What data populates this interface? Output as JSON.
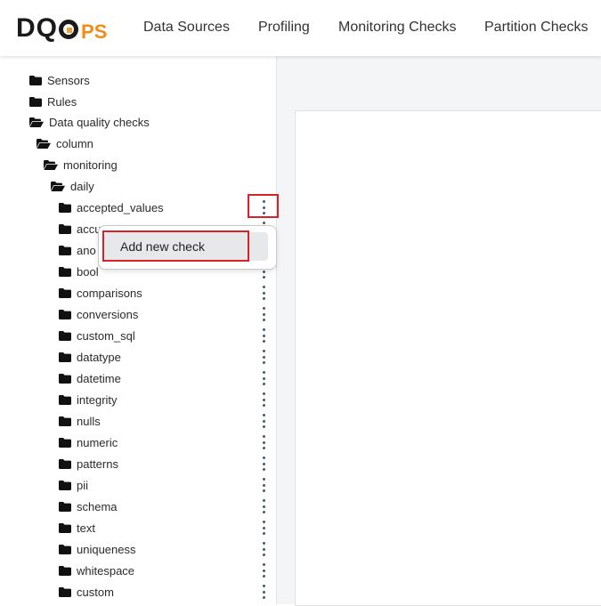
{
  "brand": {
    "logo_text": "DQOps",
    "accent": "#f08c1a"
  },
  "nav": [
    {
      "label": "Data Sources"
    },
    {
      "label": "Profiling"
    },
    {
      "label": "Monitoring Checks"
    },
    {
      "label": "Partition Checks"
    }
  ],
  "tree": {
    "top_items": [
      {
        "label": "Sensors",
        "icon": "folder-icon"
      },
      {
        "label": "Rules",
        "icon": "folder-icon"
      },
      {
        "label": "Data quality checks",
        "icon": "folder-open-icon"
      },
      {
        "label": "column",
        "icon": "folder-open-icon"
      },
      {
        "label": "monitoring",
        "icon": "folder-open-icon"
      },
      {
        "label": "daily",
        "icon": "folder-open-icon"
      }
    ],
    "categories": [
      "accepted_values",
      "accu",
      "ano",
      "bool",
      "comparisons",
      "conversions",
      "custom_sql",
      "datatype",
      "datetime",
      "integrity",
      "nulls",
      "numeric",
      "patterns",
      "pii",
      "schema",
      "text",
      "uniqueness",
      "whitespace",
      "custom"
    ]
  },
  "popup": {
    "item_label": "Add new check"
  },
  "colors": {
    "highlight": "#d8222a",
    "dots": "#4a5866"
  }
}
